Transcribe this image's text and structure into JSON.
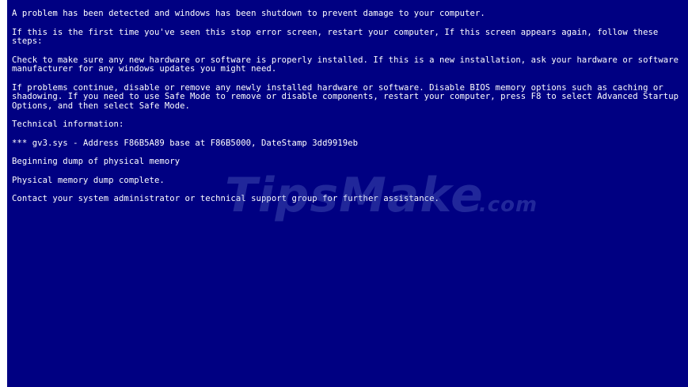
{
  "bsod": {
    "line1": "A problem has been detected and windows has been shutdown to prevent damage to your computer.",
    "line2": "If this is the first time you've seen this stop error screen, restart your computer, If this screen appears again, follow these steps:",
    "line3": "Check to make sure any new hardware or software is properly installed. If this is a new installation, ask your hardware or software manufacturer for any windows updates you might need.",
    "line4": "If problems continue, disable or remove any newly installed hardware or software. Disable BIOS memory options such as caching or shadowing. If you need to use Safe Mode to remove or disable components, restart your computer, press F8 to select Advanced Startup Options, and then select Safe Mode.",
    "line5": "Technical information:",
    "line6": "*** gv3.sys - Address F86B5A89 base at F86B5000, DateStamp 3dd9919eb",
    "line7": "Beginning dump of physical memory",
    "line8": "Physical memory dump complete.",
    "line9": "Contact your system administrator or technical support group for further assistance."
  },
  "watermark": {
    "main": "TipsMake",
    "suffix": ".com"
  },
  "colors": {
    "background": "#000082",
    "text": "#ffffff"
  }
}
